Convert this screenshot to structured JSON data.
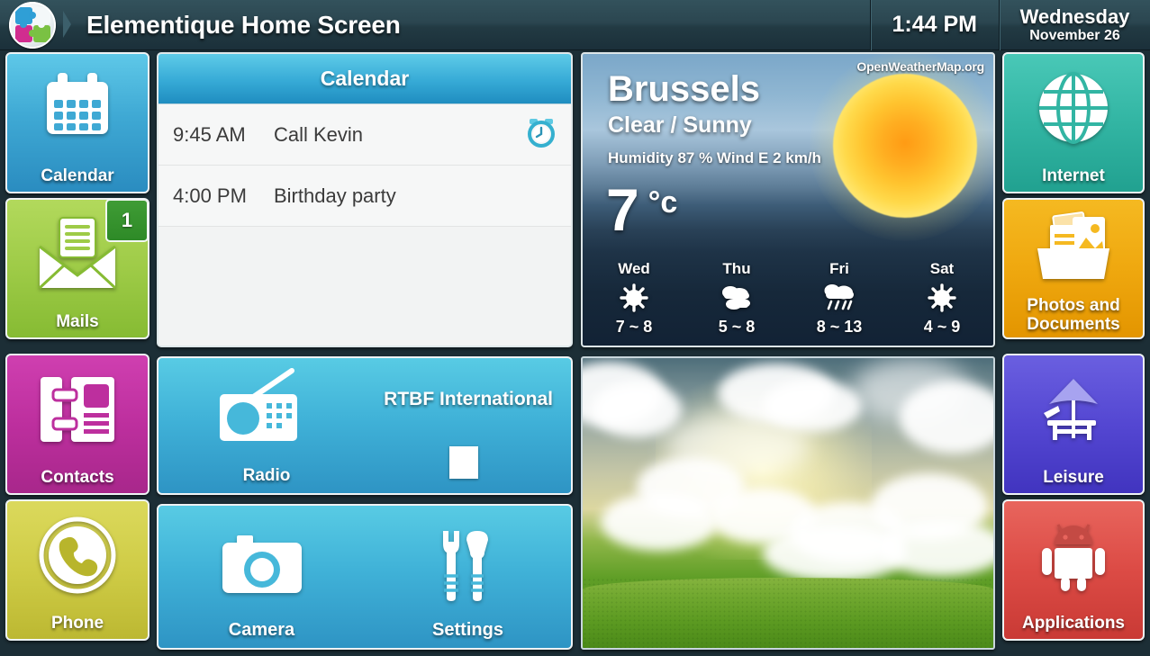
{
  "header": {
    "logo_icon": "puzzle-logo-icon",
    "title": "Elementique Home Screen",
    "time": "1:44 PM",
    "weekday": "Wednesday",
    "monthday": "November 26"
  },
  "sidebar_left": [
    {
      "label": "Calendar",
      "icon": "calendar-icon",
      "color": "#3fa9d4"
    },
    {
      "label": "Mails",
      "icon": "mail-inbox-icon",
      "color": "#9ecb47",
      "badge": "1"
    },
    {
      "label": "Contacts",
      "icon": "contacts-card-icon",
      "color": "#bd2f9e"
    },
    {
      "label": "Phone",
      "icon": "phone-handset-icon",
      "color": "#cfcc46"
    }
  ],
  "sidebar_right": [
    {
      "label": "Internet",
      "icon": "globe-icon",
      "color": "#32b5a3"
    },
    {
      "label": "Photos and Documents",
      "label_line1": "Photos and",
      "label_line2": "Documents",
      "icon": "folder-photos-icon",
      "color": "#efa80f"
    },
    {
      "label": "Leisure",
      "icon": "beach-chair-umbrella-icon",
      "color": "#5447d2"
    },
    {
      "label": "Applications",
      "icon": "android-robot-icon",
      "color": "#dc4b45"
    }
  ],
  "calendar_widget": {
    "title": "Calendar",
    "events": [
      {
        "time": "9:45 AM",
        "title": "Call Kevin",
        "alarm_icon": "alarm-clock-icon",
        "has_alarm": true
      },
      {
        "time": "4:00 PM",
        "title": "Birthday party",
        "has_alarm": false
      }
    ]
  },
  "weather_widget": {
    "source": "OpenWeatherMap.org",
    "city": "Brussels",
    "condition": "Clear / Sunny",
    "details": "Humidity 87 % Wind E 2 km/h",
    "temperature": "7",
    "unit": "°c",
    "current_icon": "sun-icon",
    "forecast": [
      {
        "day": "Wed",
        "icon": "sun-icon",
        "range": "7 ~ 8"
      },
      {
        "day": "Thu",
        "icon": "cloudy-icon",
        "range": "5 ~ 8"
      },
      {
        "day": "Fri",
        "icon": "rain-icon",
        "range": "8 ~ 13"
      },
      {
        "day": "Sat",
        "icon": "sun-icon",
        "range": "4 ~ 9"
      }
    ]
  },
  "radio_widget": {
    "label": "Radio",
    "icon": "radio-icon",
    "station": "RTBF International",
    "stop_button_icon": "stop-square-icon"
  },
  "tools_widget": {
    "items": [
      {
        "label": "Camera",
        "icon": "camera-icon"
      },
      {
        "label": "Settings",
        "icon": "wrench-screwdriver-icon"
      }
    ]
  },
  "photo_widget": {
    "name": "photo-frame-landscape"
  },
  "colors": {
    "background": "#1c2e36",
    "header_top": "#33525c",
    "header_bottom": "#1b303a",
    "accent_blue": "#36aad6"
  }
}
